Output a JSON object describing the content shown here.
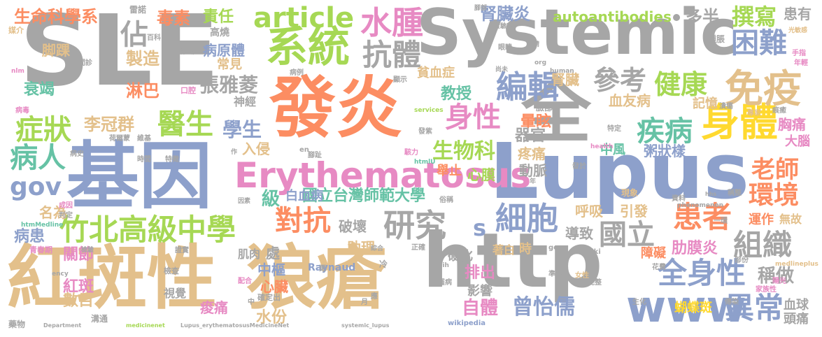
{
  "words": [
    {
      "t": "SLE",
      "c": "#a6a6a6"
    },
    {
      "t": "紅斑性",
      "c": "#e3c08b"
    },
    {
      "t": "狼瘡",
      "c": "#e3c08b"
    },
    {
      "t": "http",
      "c": "#a6a6a6"
    },
    {
      "t": "基因",
      "c": "#8da0cb"
    },
    {
      "t": "Lupus",
      "c": "#8da0cb"
    },
    {
      "t": "發炎",
      "c": "#fc8d62"
    },
    {
      "t": "Systemic",
      "c": "#a6a6a6"
    },
    {
      "t": "全",
      "c": "#a6a6a6"
    },
    {
      "t": "Erythematosus",
      "c": "#e78ac3"
    },
    {
      "t": "www",
      "c": "#8da0cb"
    },
    {
      "t": "系統",
      "c": "#a6d854"
    },
    {
      "t": "article",
      "c": "#a6d854"
    },
    {
      "t": "身體",
      "c": "#ffd92f"
    },
    {
      "t": "免疫",
      "c": "#e3c08b"
    },
    {
      "t": "水腫",
      "c": "#e78ac3"
    },
    {
      "t": "抗體",
      "c": "#a6a6a6"
    },
    {
      "t": "竹北高級中學",
      "c": "#a6d854"
    },
    {
      "t": "編輯",
      "c": "#8da0cb"
    },
    {
      "t": "細胞",
      "c": "#8da0cb"
    },
    {
      "t": "研究",
      "c": "#a6a6a6"
    },
    {
      "t": "全身性",
      "c": "#8da0cb"
    },
    {
      "t": "異常",
      "c": "#8da0cb"
    },
    {
      "t": "國立",
      "c": "#a6a6a6"
    },
    {
      "t": "組織",
      "c": "#a6a6a6"
    },
    {
      "t": "患者",
      "c": "#fc8d62"
    },
    {
      "t": "環境",
      "c": "#fc8d62"
    },
    {
      "t": "困難",
      "c": "#8da0cb"
    },
    {
      "t": "健康",
      "c": "#a6d854"
    },
    {
      "t": "參考",
      "c": "#a6a6a6"
    },
    {
      "t": "醫生",
      "c": "#a6d854"
    },
    {
      "t": "症狀",
      "c": "#a6d854"
    },
    {
      "t": "病人",
      "c": "#66c2a5"
    },
    {
      "t": "疾病",
      "c": "#66c2a5"
    },
    {
      "t": "身性",
      "c": "#e78ac3"
    },
    {
      "t": "對抗",
      "c": "#fc8d62"
    },
    {
      "t": "老師",
      "c": "#fc8d62"
    },
    {
      "t": "撰寫",
      "c": "#a6d854"
    },
    {
      "t": "gov",
      "c": "#8da0cb"
    },
    {
      "t": "生物科",
      "c": "#a6d854"
    },
    {
      "t": "曾怡儒",
      "c": "#8da0cb"
    },
    {
      "t": "自體",
      "c": "#e78ac3"
    },
    {
      "t": "學生",
      "c": "#8da0cb"
    },
    {
      "t": "張雅菱",
      "c": "#a6a6a6"
    },
    {
      "t": "生命科學系",
      "c": "#fc8d62"
    },
    {
      "t": "國立台灣師範大學",
      "c": "#66c2a5"
    },
    {
      "t": "白血病",
      "c": "#8da0cb"
    },
    {
      "t": "autoantibodies",
      "c": "#a6d854"
    },
    {
      "t": "佔",
      "c": "#a6a6a6"
    },
    {
      "t": "s",
      "c": "#8da0cb"
    },
    {
      "t": "稱做",
      "c": "#a6a6a6"
    },
    {
      "t": "肋膜炎",
      "c": "#e78ac3"
    },
    {
      "t": "責任",
      "c": "#a6d854"
    },
    {
      "t": "毒素",
      "c": "#fc8d62"
    },
    {
      "t": "腎臟炎",
      "c": "#8da0cb"
    },
    {
      "t": "多半",
      "c": "#a6a6a6"
    },
    {
      "t": "患有",
      "c": "#a6a6a6"
    },
    {
      "t": "李冠群",
      "c": "#e3c08b"
    },
    {
      "t": "教授",
      "c": "#66c2a5"
    },
    {
      "t": "級",
      "c": "#66c2a5"
    },
    {
      "t": "製造",
      "c": "#e3c08b"
    },
    {
      "t": "淋巴",
      "c": "#fc8d62"
    },
    {
      "t": "衰竭",
      "c": "#66c2a5"
    },
    {
      "t": "脚踝",
      "c": "#e3c08b"
    },
    {
      "t": "病原體",
      "c": "#8da0cb"
    },
    {
      "t": "常見",
      "c": "#e3c08b"
    },
    {
      "t": "神經",
      "c": "#a6a6a6"
    },
    {
      "t": "入侵",
      "c": "#e3c08b"
    },
    {
      "t": "名為",
      "c": "#e3c08b"
    },
    {
      "t": "病患",
      "c": "#8da0cb"
    },
    {
      "t": "血友病",
      "c": "#e3c08b"
    },
    {
      "t": "腎臟",
      "c": "#e3c08b"
    },
    {
      "t": "記憶",
      "c": "#e3c08b"
    },
    {
      "t": "暈眩",
      "c": "#fc8d62"
    },
    {
      "t": "器官",
      "c": "#a6a6a6"
    },
    {
      "t": "中風",
      "c": "#66c2a5"
    },
    {
      "t": "粥狀樣",
      "c": "#8da0cb"
    },
    {
      "t": "胸痛",
      "c": "#e78ac3"
    },
    {
      "t": "大腦",
      "c": "#e78ac3"
    },
    {
      "t": "血球",
      "c": "#a6a6a6"
    },
    {
      "t": "頭痛",
      "c": "#a6a6a6"
    },
    {
      "t": "呼吸",
      "c": "#e3c08b"
    },
    {
      "t": "引發",
      "c": "#e3c08b"
    },
    {
      "t": "導致",
      "c": "#a6a6a6"
    },
    {
      "t": "運作",
      "c": "#fc8d62"
    },
    {
      "t": "無故",
      "c": "#e3c08b"
    },
    {
      "t": "動脈",
      "c": "#a6a6a6"
    },
    {
      "t": "疼痛",
      "c": "#e3c08b"
    },
    {
      "t": "心膜",
      "c": "#a6d854"
    },
    {
      "t": "舉止",
      "c": "#fc8d62"
    },
    {
      "t": "破壞",
      "c": "#a6a6a6"
    },
    {
      "t": "助理",
      "c": "#e3c08b"
    },
    {
      "t": "排出",
      "c": "#e78ac3"
    },
    {
      "t": "影響",
      "c": "#a6a6a6"
    },
    {
      "t": "硬化",
      "c": "#a6a6a6"
    },
    {
      "t": "關節",
      "c": "#e78ac3"
    },
    {
      "t": "紅斑",
      "c": "#e78ac3"
    },
    {
      "t": "數目",
      "c": "#e3c08b"
    },
    {
      "t": "中樞",
      "c": "#8da0cb"
    },
    {
      "t": "心臟",
      "c": "#fc8d62"
    },
    {
      "t": "水份",
      "c": "#e3c08b"
    },
    {
      "t": "痠痛",
      "c": "#e78ac3"
    },
    {
      "t": "肌肉",
      "c": "#a6a6a6"
    },
    {
      "t": "處",
      "c": "#a6a6a6"
    },
    {
      "t": "Raynaud",
      "c": "#8da0cb"
    },
    {
      "t": "障礙",
      "c": "#fc8d62"
    },
    {
      "t": "蝴蝶斑",
      "c": "#ffd92f"
    },
    {
      "t": "貧血症",
      "c": "#e3c08b"
    },
    {
      "t": "雷諾",
      "c": "#a6a6a6"
    },
    {
      "t": "百科",
      "c": "#a6a6a6"
    },
    {
      "t": "媒介",
      "c": "#e3c08b"
    },
    {
      "t": "診斷",
      "c": "#a6a6a6"
    },
    {
      "t": "間診",
      "c": "#a6a6a6"
    },
    {
      "t": "口腔",
      "c": "#e78ac3"
    },
    {
      "t": "病例",
      "c": "#a6a6a6"
    },
    {
      "t": "高燒",
      "c": "#a6a6a6"
    },
    {
      "t": "腳部",
      "c": "#a6a6a6"
    },
    {
      "t": "實驗室",
      "c": "#a6a6a6"
    },
    {
      "t": "眼睛",
      "c": "#a6a6a6"
    },
    {
      "t": "顯示",
      "c": "#a6a6a6"
    },
    {
      "t": "腫脹",
      "c": "#a6a6a6"
    },
    {
      "t": "光敏感",
      "c": "#e3c08b"
    },
    {
      "t": "手指",
      "c": "#e78ac3"
    },
    {
      "t": "年輕",
      "c": "#e78ac3"
    },
    {
      "t": "病毒",
      "c": "#e78ac3"
    },
    {
      "t": "荷爾蒙",
      "c": "#a6a6a6"
    },
    {
      "t": "維基",
      "c": "#a6a6a6"
    },
    {
      "t": "時間",
      "c": "#a6a6a6"
    },
    {
      "t": "特徵",
      "c": "#a6a6a6"
    },
    {
      "t": "病史",
      "c": "#a6a6a6"
    },
    {
      "t": "發紫",
      "c": "#a6a6a6"
    },
    {
      "t": "腳趾",
      "c": "#a6a6a6"
    },
    {
      "t": "駭力",
      "c": "#e78ac3"
    },
    {
      "t": "特定",
      "c": "#a6a6a6"
    },
    {
      "t": "潰瘍",
      "c": "#a6a6a6"
    },
    {
      "t": "專家",
      "c": "#e3c08b"
    },
    {
      "t": "痕癒",
      "c": "#a6a6a6"
    },
    {
      "t": "臉部",
      "c": "#a6a6a6"
    },
    {
      "t": "health",
      "c": "#e78ac3"
    },
    {
      "t": "human",
      "c": "#a6a6a6"
    },
    {
      "t": "services",
      "c": "#a6d854"
    },
    {
      "t": "org",
      "c": "#a6a6a6"
    },
    {
      "t": "nlm",
      "c": "#e78ac3"
    },
    {
      "t": "en",
      "c": "#a6a6a6"
    },
    {
      "t": "htmlU",
      "c": "#66c2a5"
    },
    {
      "t": "發於",
      "c": "#a6a6a6"
    },
    {
      "t": "現象",
      "c": "#e3c08b"
    },
    {
      "t": "資料",
      "c": "#a6a6a6"
    },
    {
      "t": "稱整",
      "c": "#a6a6a6"
    },
    {
      "t": "成因",
      "c": "#e78ac3"
    },
    {
      "t": "判定",
      "c": "#a6a6a6"
    },
    {
      "t": "htmMedline",
      "c": "#66c2a5"
    },
    {
      "t": "因素",
      "c": "#a6a6a6"
    },
    {
      "t": "俗稱",
      "c": "#a6a6a6"
    },
    {
      "t": "phenomenon",
      "c": "#a6a6a6"
    },
    {
      "t": "一環",
      "c": "#a6a6a6"
    },
    {
      "t": "青春期",
      "c": "#e78ac3"
    },
    {
      "t": "檢驗",
      "c": "#a6a6a6"
    },
    {
      "t": "證實",
      "c": "#a6a6a6"
    },
    {
      "t": "綜合",
      "c": "#a6a6a6"
    },
    {
      "t": "正確",
      "c": "#a6a6a6"
    },
    {
      "t": "gene",
      "c": "#a6a6a6"
    },
    {
      "t": "wiki",
      "c": "#a6a6a6"
    },
    {
      "t": "著白",
      "c": "#e3c08b"
    },
    {
      "t": "時",
      "c": "#e3c08b"
    },
    {
      "t": "花費",
      "c": "#a6a6a6"
    },
    {
      "t": "部份",
      "c": "#a6a6a6"
    },
    {
      "t": "medlineplus",
      "c": "#e3c08b"
    },
    {
      "t": "ency",
      "c": "#a6a6a6"
    },
    {
      "t": "更",
      "c": "#a6a6a6"
    },
    {
      "t": "冷",
      "c": "#a6a6a6"
    },
    {
      "t": "nih",
      "c": "#a6a6a6"
    },
    {
      "t": "罹病",
      "c": "#a6a6a6"
    },
    {
      "t": "準確",
      "c": "#a6a6a6"
    },
    {
      "t": "女性",
      "c": "#e3c08b"
    },
    {
      "t": "完整",
      "c": "#a6a6a6"
    },
    {
      "t": "家族性",
      "c": "#e78ac3"
    },
    {
      "t": "陽光",
      "c": "#e78ac3"
    },
    {
      "t": "檢查",
      "c": "#a6a6a6"
    },
    {
      "t": "配合",
      "c": "#e78ac3"
    },
    {
      "t": "確定出",
      "c": "#a6a6a6"
    },
    {
      "t": "視覺",
      "c": "#a6a6a6"
    },
    {
      "t": "中",
      "c": "#a6a6a6"
    },
    {
      "t": "溝通",
      "c": "#a6a6a6"
    },
    {
      "t": "藥物",
      "c": "#a6a6a6"
    },
    {
      "t": "Department",
      "c": "#a6a6a6"
    },
    {
      "t": "medicinenet",
      "c": "#a6d854"
    },
    {
      "t": "Lupus_erythematosusMedicineNet",
      "c": "#a6a6a6"
    },
    {
      "t": "systemic_lupus",
      "c": "#a6a6a6"
    },
    {
      "t": "wikipedia",
      "c": "#8da0cb"
    },
    {
      "t": "生化",
      "c": "#a6a6a6"
    },
    {
      "t": "傳染",
      "c": "#a6a6a6"
    },
    {
      "t": "月",
      "c": "#a6a6a6"
    },
    {
      "t": "應",
      "c": "#a6a6a6"
    },
    {
      "t": "尚未",
      "c": "#a6a6a6"
    },
    {
      "t": "年",
      "c": "#a6a6a6"
    },
    {
      "t": "作",
      "c": "#a6a6a6"
    },
    {
      "t": "請",
      "c": "#a6a6a6"
    },
    {
      "t": "hhs",
      "c": "#a6a6a6"
    }
  ]
}
